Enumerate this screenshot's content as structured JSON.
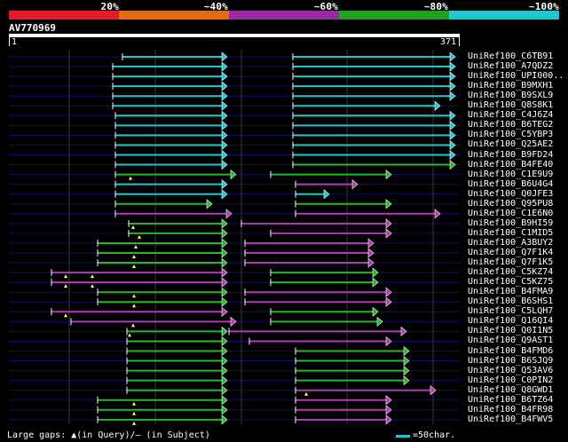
{
  "legend": {
    "bands": [
      {
        "label": "20%",
        "color": "#e8192c"
      },
      {
        "label": "~40%",
        "color": "#e46b12"
      },
      {
        "label": "~60%",
        "color": "#9b2ba5"
      },
      {
        "label": "~80%",
        "color": "#20a020"
      },
      {
        "label": "~100%",
        "color": "#1fc7d0"
      }
    ]
  },
  "query": {
    "id": "AV770969",
    "start": "1",
    "end": "371"
  },
  "footer": {
    "gaps_text": "Large gaps: ▲(in Query)/– (in Subject)",
    "scale_text": "=50char."
  },
  "hits": [
    {
      "name": "UniRef100_C6TB91",
      "segs": [
        [
          138,
          255,
          "c"
        ],
        [
          330,
          512,
          "c"
        ]
      ]
    },
    {
      "name": "UniRef100_A7QDZ2",
      "segs": [
        [
          127,
          255,
          "c"
        ],
        [
          330,
          512,
          "c"
        ]
      ]
    },
    {
      "name": "UniRef100_UPI000..",
      "segs": [
        [
          127,
          255,
          "c"
        ],
        [
          330,
          512,
          "c"
        ]
      ]
    },
    {
      "name": "UniRef100_B9MXH1",
      "segs": [
        [
          127,
          255,
          "c"
        ],
        [
          330,
          512,
          "c"
        ]
      ]
    },
    {
      "name": "UniRef100_B9SXL9",
      "segs": [
        [
          127,
          255,
          "c"
        ],
        [
          330,
          512,
          "c"
        ]
      ]
    },
    {
      "name": "UniRef100_Q8S8K1",
      "segs": [
        [
          127,
          255,
          "c"
        ],
        [
          330,
          495,
          "c"
        ]
      ]
    },
    {
      "name": "UniRef100_C4J6Z4",
      "segs": [
        [
          130,
          255,
          "c"
        ],
        [
          330,
          512,
          "c"
        ]
      ]
    },
    {
      "name": "UniRef100_B6TEG2",
      "segs": [
        [
          130,
          255,
          "c"
        ],
        [
          330,
          512,
          "c"
        ]
      ]
    },
    {
      "name": "UniRef100_C5YBP3",
      "segs": [
        [
          130,
          255,
          "c"
        ],
        [
          330,
          512,
          "c"
        ]
      ]
    },
    {
      "name": "UniRef100_Q25AE2",
      "segs": [
        [
          130,
          255,
          "c"
        ],
        [
          330,
          512,
          "c"
        ]
      ]
    },
    {
      "name": "UniRef100_B9FD24",
      "segs": [
        [
          130,
          255,
          "c"
        ],
        [
          330,
          512,
          "c"
        ]
      ]
    },
    {
      "name": "UniRef100_B4FE40",
      "segs": [
        [
          130,
          255,
          "c"
        ],
        [
          330,
          512,
          "g"
        ]
      ]
    },
    {
      "name": "UniRef100_C1E9U9",
      "segs": [
        [
          130,
          265,
          "g"
        ],
        [
          305,
          440,
          "g"
        ]
      ],
      "marks": [
        147
      ]
    },
    {
      "name": "UniRef100_B6U4G4",
      "segs": [
        [
          130,
          255,
          "c"
        ],
        [
          333,
          402,
          "p"
        ]
      ]
    },
    {
      "name": "UniRef100_Q0JFE3",
      "segs": [
        [
          130,
          255,
          "c"
        ],
        [
          333,
          370,
          "c"
        ]
      ]
    },
    {
      "name": "UniRef100_Q95PU8",
      "segs": [
        [
          130,
          238,
          "g"
        ],
        [
          333,
          440,
          "g"
        ]
      ]
    },
    {
      "name": "UniRef100_C1E6N0",
      "segs": [
        [
          130,
          260,
          "p"
        ],
        [
          333,
          495,
          "p"
        ]
      ]
    },
    {
      "name": "UniRef100_B9HI59",
      "segs": [
        [
          145,
          255,
          "g"
        ],
        [
          272,
          440,
          "p"
        ]
      ],
      "marks": [
        150
      ]
    },
    {
      "name": "UniRef100_C1MID5",
      "segs": [
        [
          145,
          255,
          "g"
        ],
        [
          305,
          440,
          "p"
        ]
      ],
      "marks": [
        157
      ]
    },
    {
      "name": "UniRef100_A3BUY2",
      "segs": [
        [
          110,
          255,
          "g"
        ],
        [
          276,
          420,
          "p"
        ]
      ],
      "marks": [
        153
      ]
    },
    {
      "name": "UniRef100_Q7F1K4",
      "segs": [
        [
          110,
          255,
          "g"
        ],
        [
          276,
          420,
          "p"
        ]
      ],
      "marks": [
        151
      ]
    },
    {
      "name": "UniRef100_Q7F1K5",
      "segs": [
        [
          110,
          255,
          "g"
        ],
        [
          276,
          420,
          "p"
        ]
      ],
      "marks": [
        151
      ]
    },
    {
      "name": "UniRef100_C5KZ74",
      "segs": [
        [
          58,
          255,
          "p"
        ],
        [
          305,
          425,
          "g"
        ]
      ],
      "marks": [
        74,
        104
      ]
    },
    {
      "name": "UniRef100_C5KZ75",
      "segs": [
        [
          58,
          255,
          "p"
        ],
        [
          305,
          425,
          "g"
        ]
      ],
      "marks": [
        74,
        104
      ]
    },
    {
      "name": "UniRef100_B4FMA9",
      "segs": [
        [
          110,
          255,
          "g"
        ],
        [
          276,
          440,
          "p"
        ]
      ],
      "marks": [
        151
      ]
    },
    {
      "name": "UniRef100_B6SHS1",
      "segs": [
        [
          110,
          255,
          "g"
        ],
        [
          276,
          440,
          "p"
        ]
      ],
      "marks": [
        151
      ]
    },
    {
      "name": "UniRef100_C5LQH7",
      "segs": [
        [
          58,
          255,
          "p"
        ],
        [
          305,
          425,
          "g"
        ]
      ],
      "marks": [
        74
      ]
    },
    {
      "name": "UniRef100_Q16QI4",
      "segs": [
        [
          80,
          265,
          "p"
        ],
        [
          305,
          430,
          "g"
        ]
      ],
      "marks": [
        150
      ]
    },
    {
      "name": "UniRef100_Q0I1N5",
      "segs": [
        [
          143,
          255,
          "g"
        ],
        [
          258,
          457,
          "p"
        ]
      ],
      "marks": [
        146
      ]
    },
    {
      "name": "UniRef100_Q9AST1",
      "segs": [
        [
          143,
          255,
          "g"
        ],
        [
          281,
          440,
          "p"
        ]
      ]
    },
    {
      "name": "UniRef100_B4FMD6",
      "segs": [
        [
          143,
          255,
          "g"
        ],
        [
          333,
          460,
          "g"
        ]
      ]
    },
    {
      "name": "UniRef100_B6SJQ9",
      "segs": [
        [
          143,
          255,
          "g"
        ],
        [
          333,
          460,
          "g"
        ]
      ]
    },
    {
      "name": "UniRef100_Q53AV6",
      "segs": [
        [
          143,
          255,
          "g"
        ],
        [
          333,
          460,
          "g"
        ]
      ]
    },
    {
      "name": "UniRef100_C0PIN2",
      "segs": [
        [
          143,
          255,
          "g"
        ],
        [
          333,
          460,
          "g"
        ]
      ]
    },
    {
      "name": "UniRef100_Q8GWD1",
      "segs": [
        [
          143,
          255,
          "g"
        ],
        [
          333,
          490,
          "p"
        ]
      ],
      "marks": [
        345
      ]
    },
    {
      "name": "UniRef100_B6TZ64",
      "segs": [
        [
          110,
          255,
          "g"
        ],
        [
          333,
          440,
          "p"
        ]
      ],
      "marks": [
        151
      ]
    },
    {
      "name": "UniRef100_B4FR98",
      "segs": [
        [
          110,
          255,
          "g"
        ],
        [
          333,
          440,
          "p"
        ]
      ],
      "marks": [
        151
      ]
    },
    {
      "name": "UniRef100_B4FWV5",
      "segs": [
        [
          110,
          255,
          "g"
        ],
        [
          333,
          440,
          "p"
        ]
      ],
      "marks": [
        151
      ]
    }
  ]
}
